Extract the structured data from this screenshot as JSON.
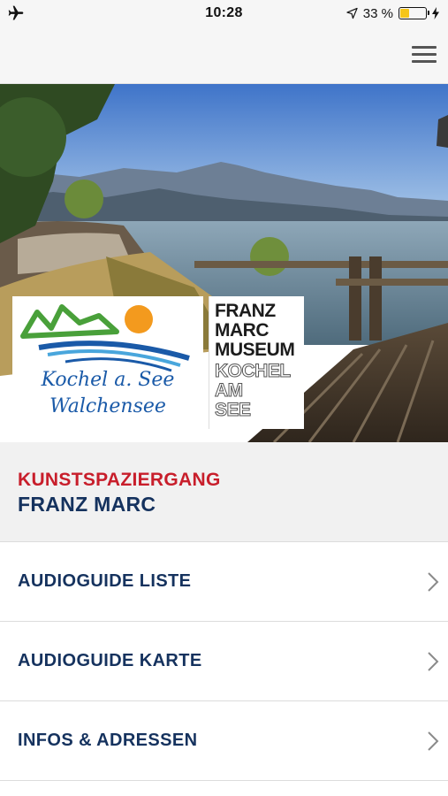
{
  "status_bar": {
    "time": "10:28",
    "battery_percent": "33 %",
    "battery_level": 0.33,
    "icons": [
      "airplane-icon",
      "location-arrow-icon",
      "battery-icon",
      "charging-bolt-icon"
    ]
  },
  "nav": {
    "menu_icon": "hamburger-menu-icon"
  },
  "hero": {
    "logos": {
      "kochel": {
        "line1": "Kochel a. See",
        "line2": "Walchensee"
      },
      "museum": {
        "line1": "FRANZ",
        "line2": "MARC",
        "line3": "MUSEUM",
        "line4": "KOCHEL",
        "line5": "AM",
        "line6": "SEE"
      }
    }
  },
  "header": {
    "kicker": "KUNSTSPAZIERGANG",
    "title": "FRANZ MARC"
  },
  "menu": {
    "items": [
      {
        "label": "AUDIOGUIDE LISTE",
        "icon": "chevron-right-icon"
      },
      {
        "label": "AUDIOGUIDE KARTE",
        "icon": "chevron-right-icon"
      },
      {
        "label": "INFOS & ADRESSEN",
        "icon": "chevron-right-icon"
      }
    ]
  },
  "colors": {
    "kicker": "#c81e2b",
    "title": "#15325e",
    "background": "#f1f1f1",
    "battery": "#f5c518"
  }
}
